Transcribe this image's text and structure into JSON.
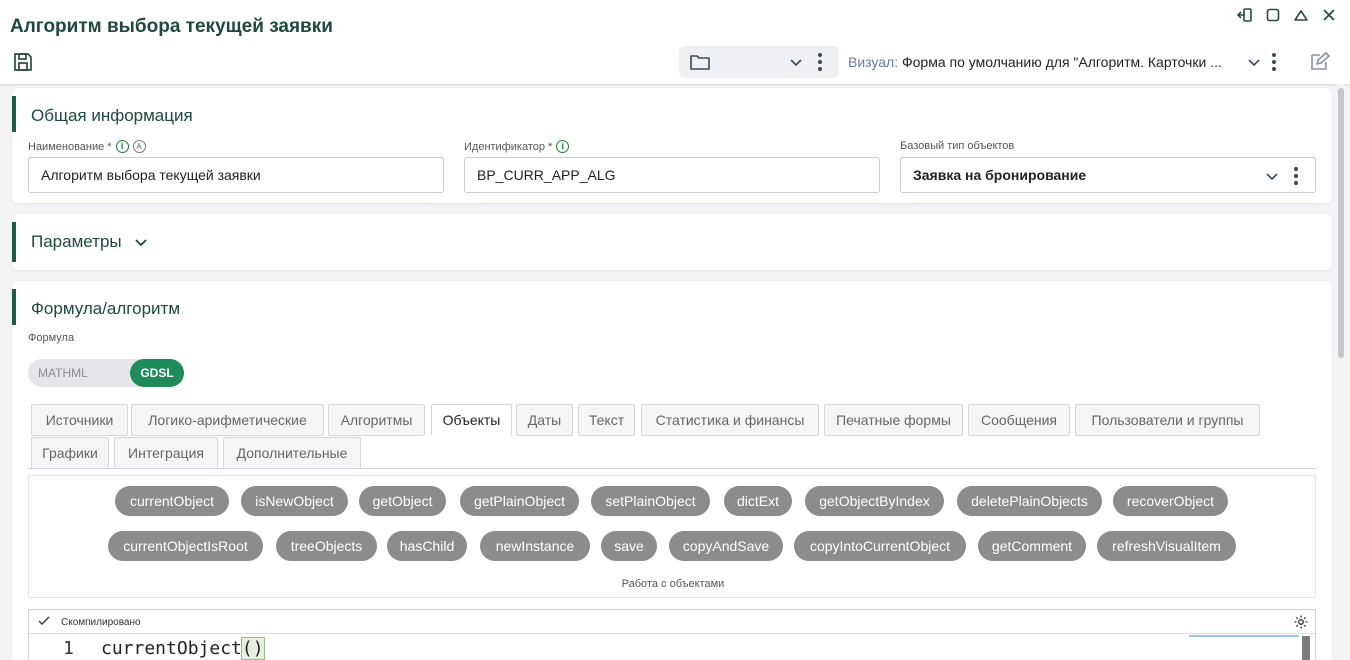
{
  "header": {
    "title": "Алгоритм выбора текущей заявки",
    "visual_label": "Визуал:",
    "visual_value": "Форма по умолчанию для \"Алгоритм. Карточки ..."
  },
  "sections": {
    "general": {
      "title": "Общая информация",
      "name_label": "Наименование *",
      "name_value": "Алгоритм выбора текущей заявки",
      "id_label": "Идентификатор *",
      "id_value": "BP_CURR_APP_ALG",
      "base_label": "Базовый тип объектов",
      "base_value": "Заявка на бронирование"
    },
    "params": {
      "title": "Параметры"
    },
    "formula": {
      "title": "Формула/алгоритм",
      "formula_label": "Формула",
      "toggle": {
        "option1": "MATHML",
        "option2": "GDSL",
        "active": "GDSL"
      }
    }
  },
  "tabs": {
    "row1": [
      "Источники",
      "Логико-арифметические",
      "Алгоритмы",
      "Объекты",
      "Даты",
      "Текст",
      "Статистика и финансы",
      "Печатные формы",
      "Сообщения",
      "Пользователи и группы"
    ],
    "row2": [
      "Графики",
      "Интеграция",
      "Дополнительные"
    ],
    "active": "Объекты"
  },
  "functions": {
    "row1": [
      "currentObject",
      "isNewObject",
      "getObject",
      "getPlainObject",
      "setPlainObject",
      "dictExt",
      "getObjectByIndex",
      "deletePlainObjects",
      "recoverObject"
    ],
    "row2": [
      "currentObjectIsRoot",
      "treeObjects",
      "hasChild",
      "newInstance",
      "save",
      "copyAndSave",
      "copyIntoCurrentObject",
      "getComment",
      "refreshVisualItem"
    ],
    "caption": "Работа с объектами"
  },
  "editor": {
    "status": "Скомпилировано",
    "line_number": "1",
    "code_name": "currentObject",
    "code_parens": "()"
  },
  "colors": {
    "accent": "#1f5a43",
    "toggle_active": "#1f8a5a",
    "chip": "#8c8c8c",
    "info": "#1e7d3c"
  }
}
